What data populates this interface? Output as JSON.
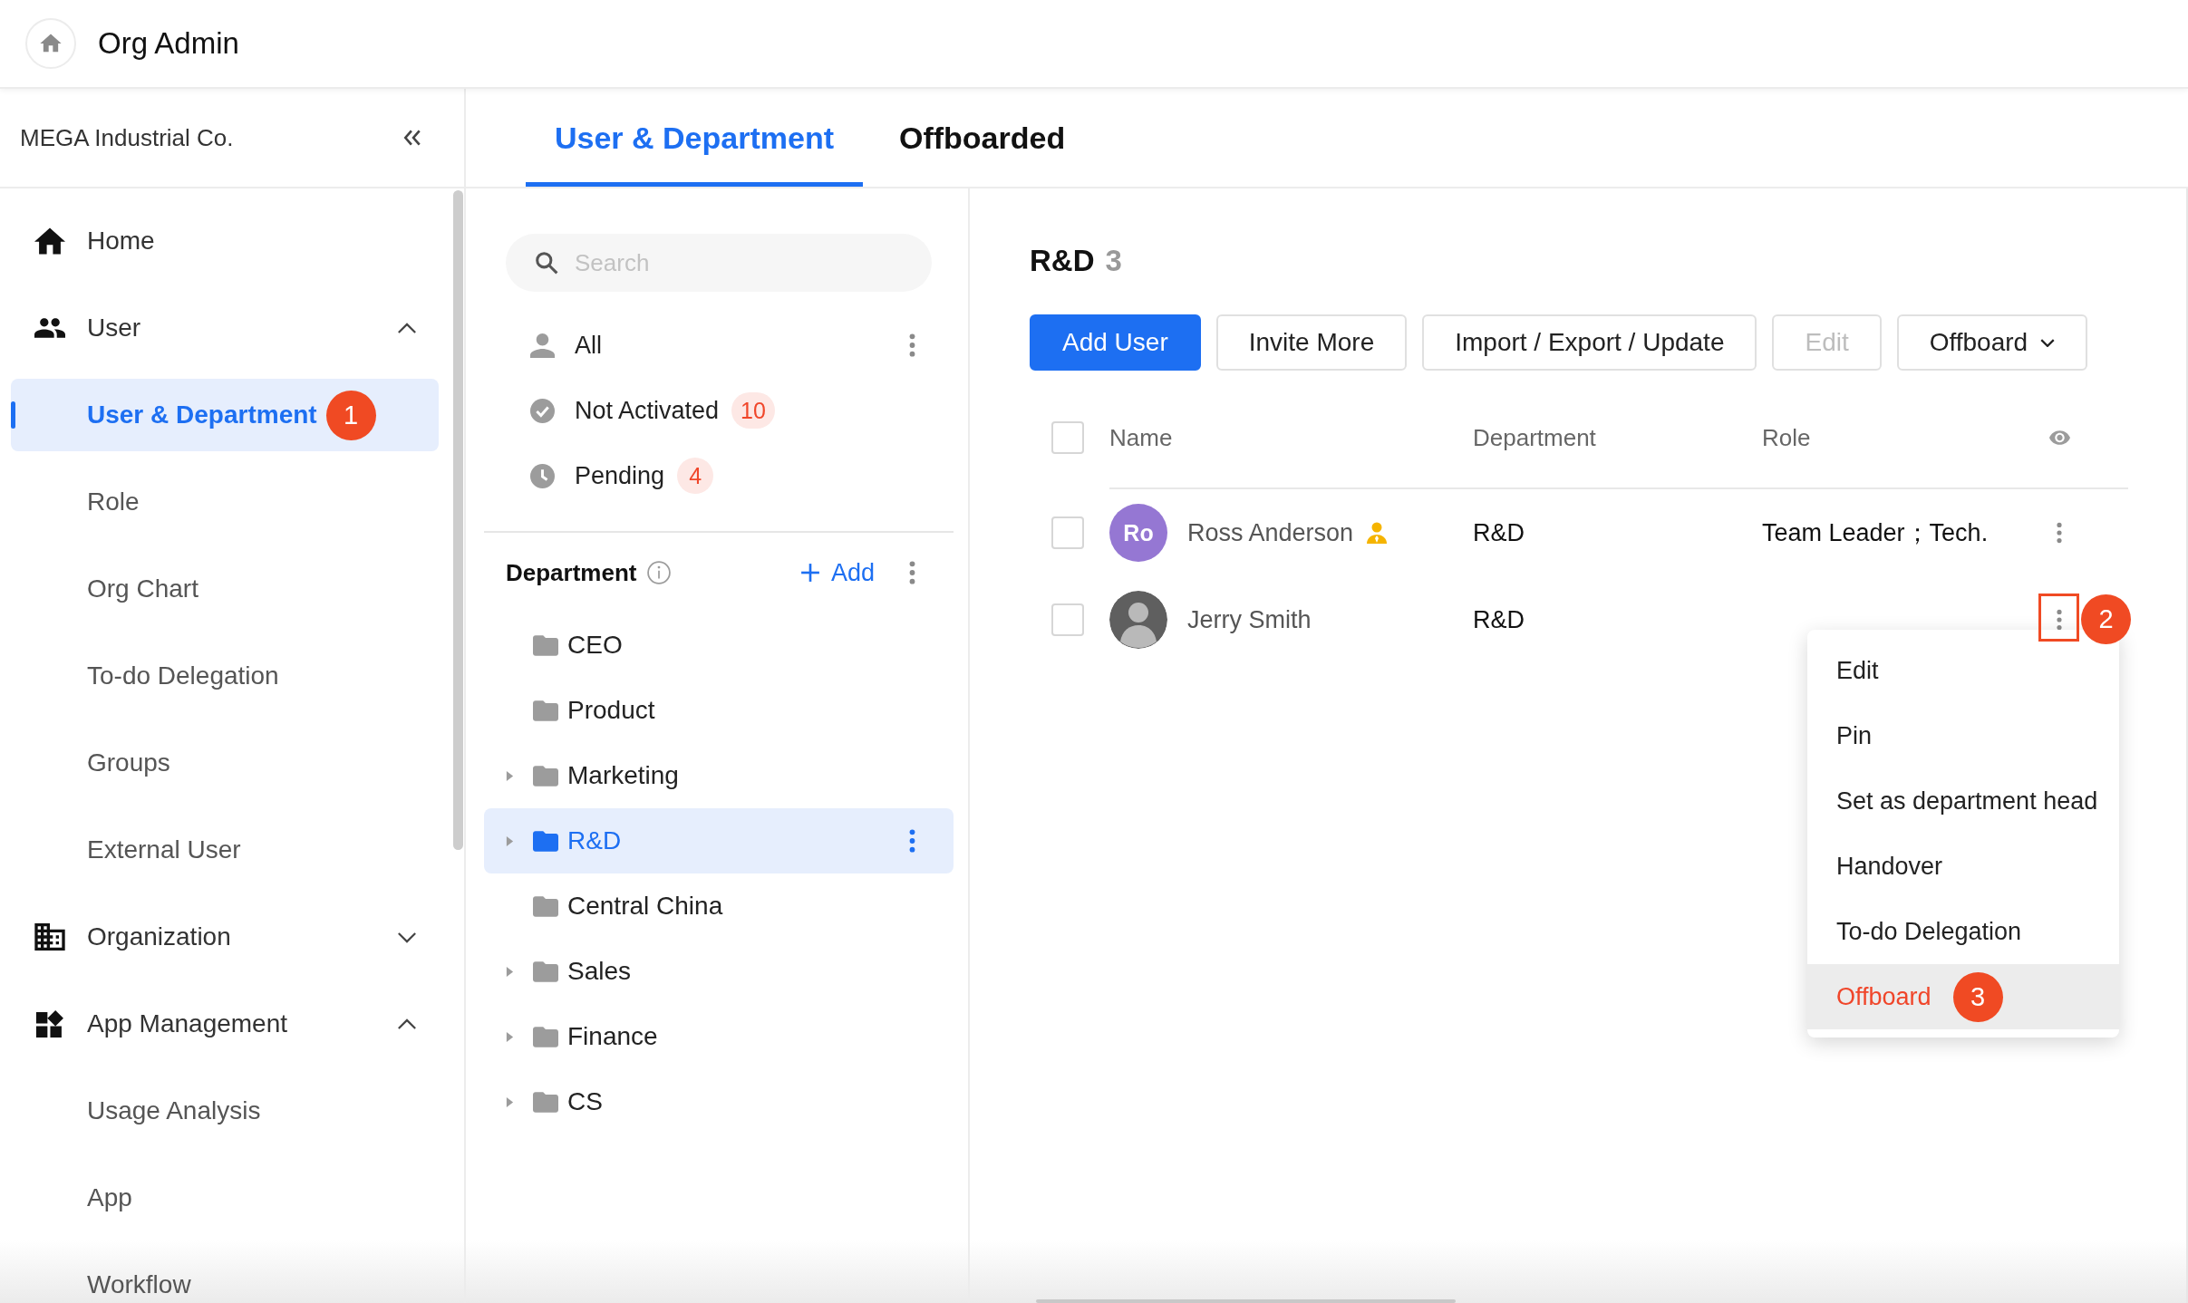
{
  "header": {
    "title": "Org Admin"
  },
  "sidebar": {
    "company": "MEGA Industrial Co.",
    "items": [
      {
        "label": "Home",
        "kind": "home",
        "selected": false
      },
      {
        "label": "User",
        "kind": "users",
        "selected": false,
        "expanded": true,
        "children": [
          {
            "label": "User & Department",
            "selected": true,
            "step": "1"
          },
          {
            "label": "Role",
            "selected": false
          },
          {
            "label": "Org Chart",
            "selected": false
          },
          {
            "label": "To-do Delegation",
            "selected": false
          },
          {
            "label": "Groups",
            "selected": false
          },
          {
            "label": "External User",
            "selected": false
          }
        ]
      },
      {
        "label": "Organization",
        "kind": "organization",
        "selected": false,
        "expanded": false
      },
      {
        "label": "App Management",
        "kind": "apps",
        "selected": false,
        "expanded": true,
        "children": [
          {
            "label": "Usage Analysis",
            "selected": false
          },
          {
            "label": "App",
            "selected": false
          },
          {
            "label": "Workflow",
            "selected": false
          }
        ]
      }
    ]
  },
  "tabs": [
    {
      "label": "User & Department",
      "selected": true
    },
    {
      "label": "Offboarded",
      "selected": false
    }
  ],
  "filters": {
    "search": {
      "placeholder": "Search"
    },
    "items": [
      {
        "label": "All",
        "kind": "all",
        "selected": false,
        "has_menu": true
      },
      {
        "label": "Not Activated",
        "kind": "inactive",
        "count": "10",
        "selected": false,
        "has_menu": false
      },
      {
        "label": "Pending",
        "kind": "pending",
        "count": "4",
        "selected": false,
        "has_menu": false
      }
    ]
  },
  "departments": {
    "title": "Department",
    "add_label": "Add",
    "items": [
      {
        "label": "CEO",
        "selected": false
      },
      {
        "label": "Product",
        "selected": false
      },
      {
        "label": "Marketing",
        "selected": false,
        "expanded": false
      },
      {
        "label": "R&D",
        "selected": true,
        "expanded": false
      },
      {
        "label": "Central China",
        "selected": false
      },
      {
        "label": "Sales",
        "selected": false,
        "expanded": false
      },
      {
        "label": "Finance",
        "selected": false,
        "expanded": false
      },
      {
        "label": "CS",
        "selected": false,
        "expanded": false
      }
    ]
  },
  "department_view": {
    "name": "R&D",
    "count": "3",
    "actions": [
      {
        "label": "Add User",
        "kind": "primary",
        "disabled": false
      },
      {
        "label": "Invite More",
        "kind": "default",
        "disabled": false
      },
      {
        "label": "Import / Export / Update",
        "kind": "default",
        "disabled": false
      },
      {
        "label": "Edit",
        "kind": "default",
        "disabled": true
      },
      {
        "label": "Offboard",
        "kind": "dropdown",
        "disabled": false
      }
    ],
    "table": {
      "columns": [
        "Name",
        "Department",
        "Role"
      ],
      "all_checked": false,
      "rows": [
        {
          "name": "Ross Anderson",
          "avatar": {
            "kind": "initials",
            "text": "Ro"
          },
          "department_head": true,
          "department": "R&D",
          "role": "Team Leader；Tech.",
          "checked": false
        },
        {
          "name": "Jerry Smith",
          "avatar": {
            "kind": "photo"
          },
          "department_head": false,
          "department": "R&D",
          "checked": false,
          "step": "2",
          "menu": [
            {
              "label": "Edit",
              "kind": "normal",
              "highlighted": false
            },
            {
              "label": "Pin",
              "kind": "normal",
              "highlighted": false
            },
            {
              "label": "Set as department head",
              "kind": "normal",
              "highlighted": false
            },
            {
              "label": "Handover",
              "kind": "normal",
              "highlighted": false
            },
            {
              "label": "To-do Delegation",
              "kind": "normal",
              "highlighted": false
            },
            {
              "label": "Offboard",
              "kind": "danger",
              "highlighted": true,
              "step": "3"
            }
          ]
        }
      ]
    }
  }
}
